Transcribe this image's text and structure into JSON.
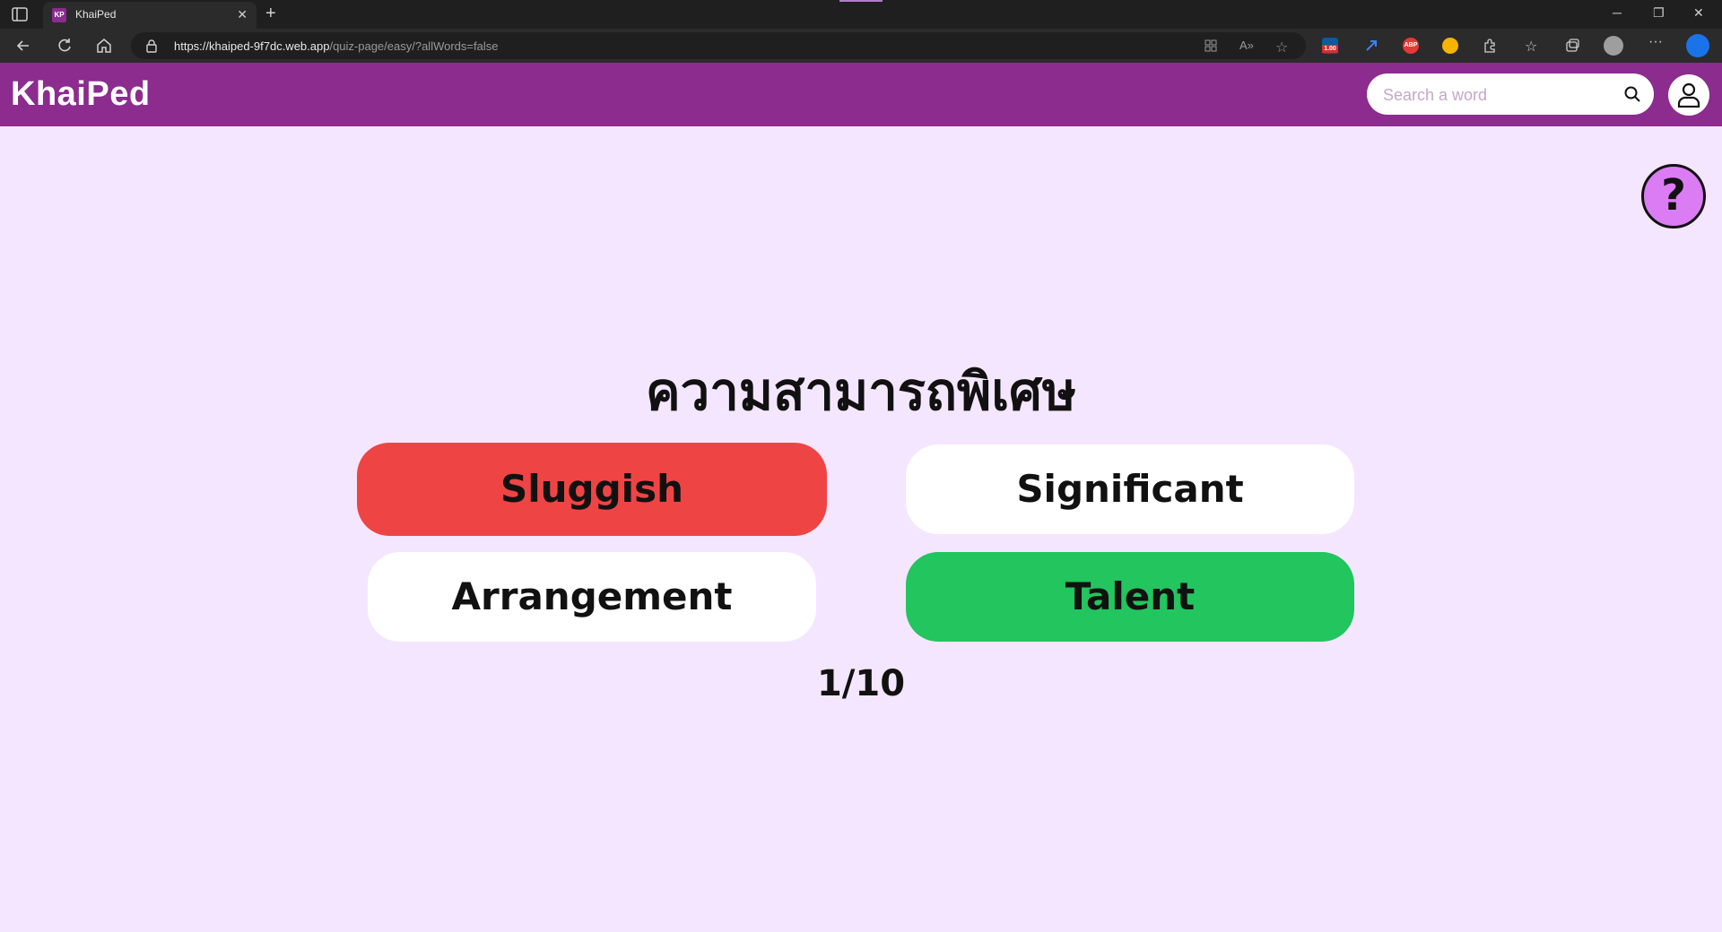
{
  "browser": {
    "tab_title": "KhaiPed",
    "favicon_text": "KP",
    "url_host": "https://khaiped-9f7dc.web.app",
    "url_path": "/quiz-page/easy/?allWords=false",
    "ext_badge": "1.00",
    "abp_label": "ABP"
  },
  "header": {
    "logo": "KhaiPed",
    "search_placeholder": "Search a word",
    "brand_color": "#8b2c8e"
  },
  "quiz": {
    "help_label": "?",
    "question": "ความสามารถพิเศษ",
    "answers": [
      {
        "label": "Sluggish",
        "state": "wrong",
        "color": "#ef4444"
      },
      {
        "label": "Significant",
        "state": "neutral",
        "color": "#ffffff"
      },
      {
        "label": "Arrangement",
        "state": "neutral",
        "color": "#ffffff"
      },
      {
        "label": "Talent",
        "state": "correct",
        "color": "#22c55e"
      }
    ],
    "progress": "1/10"
  }
}
